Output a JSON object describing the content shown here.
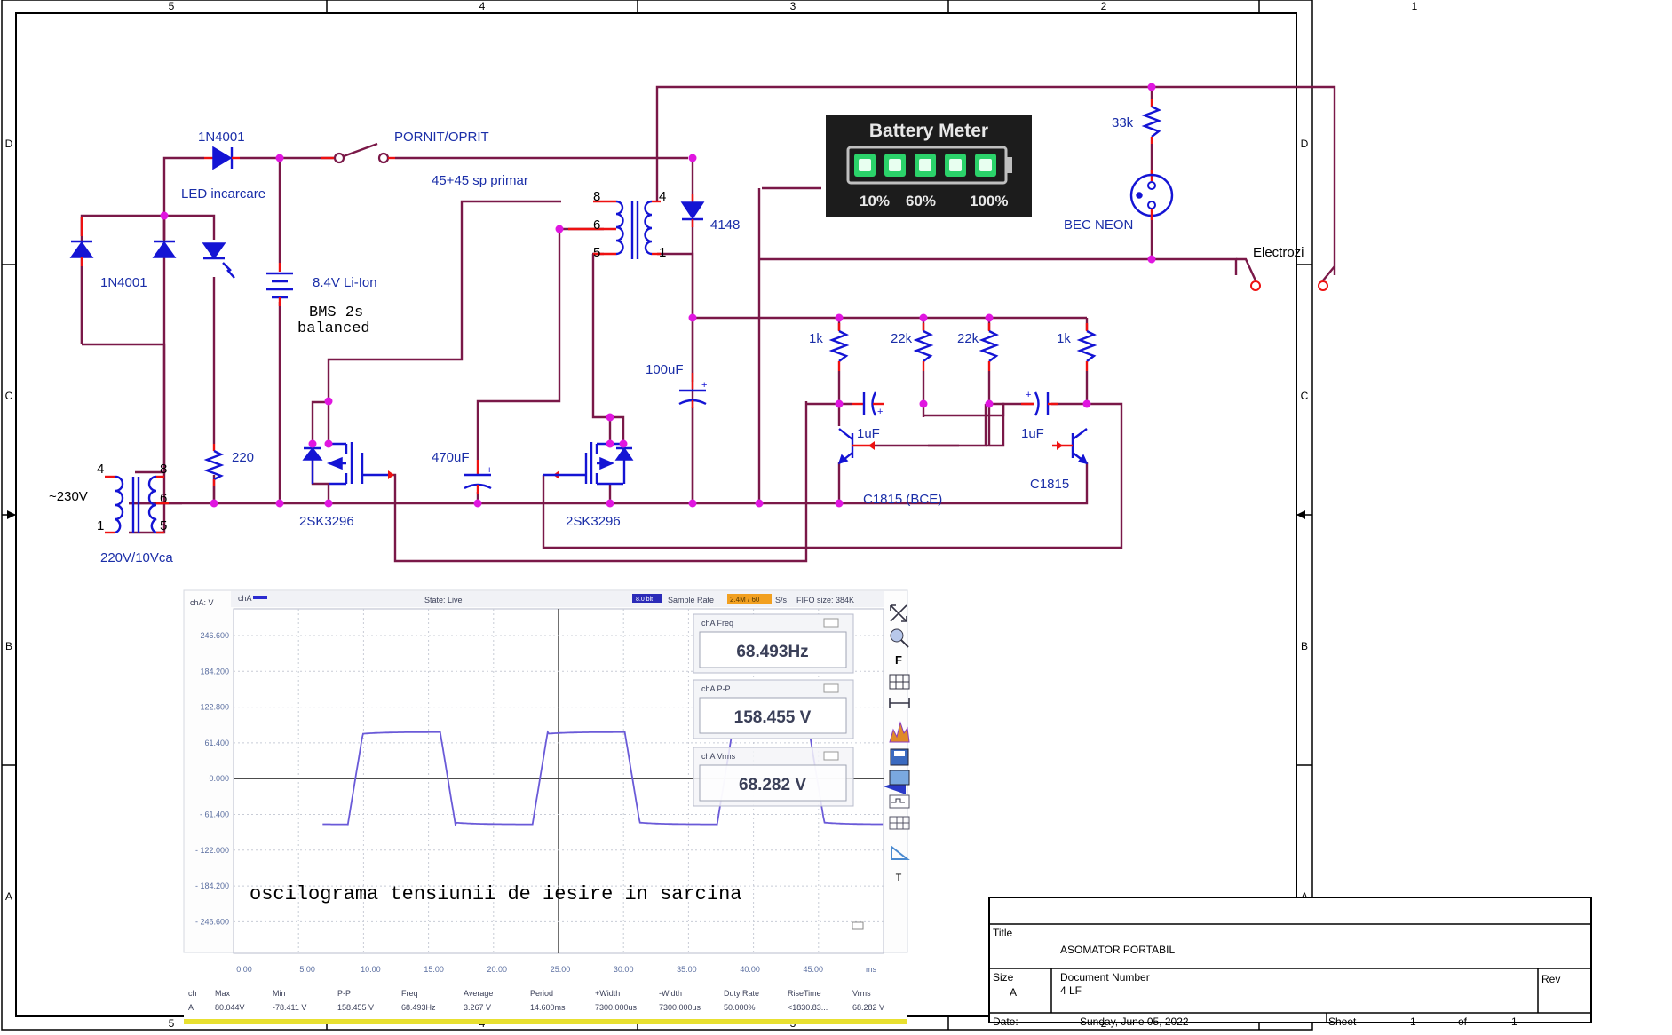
{
  "frame": {
    "columns": [
      "5",
      "4",
      "3",
      "2",
      "1"
    ],
    "rows": [
      "D",
      "C",
      "B",
      "A"
    ]
  },
  "labels": {
    "d_1n4001_top": "1N4001",
    "pornit": "PORNIT/OPRIT",
    "led": "LED incarcare",
    "d_1n4001_left": "1N4001",
    "batt": "8.4V Li-Ion",
    "bms_l1": "BMS 2s",
    "bms_l2": "balanced",
    "primar": "45+45 sp primar",
    "d4148": "4148",
    "c100": "100uF",
    "c470": "470uF",
    "r220": "220",
    "ac_in": "~230V",
    "tr_in": "220V/10Vca",
    "q1": "2SK3296",
    "q2": "2SK3296",
    "r1k_a": "1k",
    "r22k_a": "22k",
    "r22k_b": "22k",
    "r1k_b": "1k",
    "c1u_a": "1uF",
    "c1u_b": "1uF",
    "tr_a": "C1815 (BCE)",
    "tr_b": "C1815",
    "r33k": "33k",
    "neon": "BEC NEON",
    "electrozi": "Electrozi",
    "pins": {
      "p4": "4",
      "p8": "8",
      "p6": "6",
      "p1": "1",
      "p5": "5",
      "t8": "8",
      "t6": "6",
      "t5": "5",
      "t4": "4",
      "t1": "1"
    }
  },
  "battery_meter": {
    "title": "Battery Meter",
    "marks": [
      "10%",
      "60%",
      "100%"
    ],
    "bars": 5
  },
  "scope": {
    "y_unit": "chA: V",
    "legend": "chA",
    "state": "State: Live",
    "chip": "8.0 bit",
    "sample_rate_label": "Sample Rate",
    "sample_rate_value": "2.4M / 60",
    "sample_rate_suffix": "S/s",
    "fifo": "FIFO size: 384K",
    "y_ticks": [
      "246.600",
      "184.200",
      "122.800",
      "61.400",
      "0.000",
      "- 61.400",
      "- 122.000",
      "- 184.200",
      "- 246.600"
    ],
    "x_ticks": [
      "0.00",
      "5.00",
      "10.00",
      "15.00",
      "20.00",
      "25.00",
      "30.00",
      "35.00",
      "40.00",
      "45.00"
    ],
    "x_unit": "ms",
    "freq_title": "chA Freq",
    "freq_value": "68.493Hz",
    "pp_title": "chA P-P",
    "pp_value": "158.455 V",
    "vrms_title": "chA Vrms",
    "vrms_value": "68.282 V",
    "caption": "oscilograma tensiunii de iesire in sarcina",
    "table_headers": [
      "ch",
      "Max",
      "Min",
      "P-P",
      "Freq",
      "Average",
      "Period",
      "+Width",
      "-Width",
      "Duty Rate",
      "RiseTime",
      "Vrms"
    ],
    "table_row": [
      "A",
      "80.044V",
      "-78.411 V",
      "158.455 V",
      "68.493Hz",
      "3.267 V",
      "14.600ms",
      "7300.000us",
      "7300.000us",
      "50.000%",
      "<1830.83...",
      "68.282 V"
    ],
    "side_letters": [
      "F",
      "T"
    ]
  },
  "title_block": {
    "title_label": "Title",
    "title": "ASOMATOR PORTABIL",
    "size_label": "Size",
    "size": "A",
    "docnum_label": "Document Number",
    "docnum": "4 LF",
    "rev_label": "Rev",
    "date_label": "Date:",
    "date": "Sunday, June 05, 2022",
    "sheet_label": "Sheet",
    "sheet": "1",
    "of_label": "of",
    "of": "1"
  },
  "colors": {
    "wire": "#7a1848",
    "component": "#1414d4",
    "junction": "#e016e0",
    "pin": "#ee1111",
    "trace": "#6a5ad8"
  }
}
